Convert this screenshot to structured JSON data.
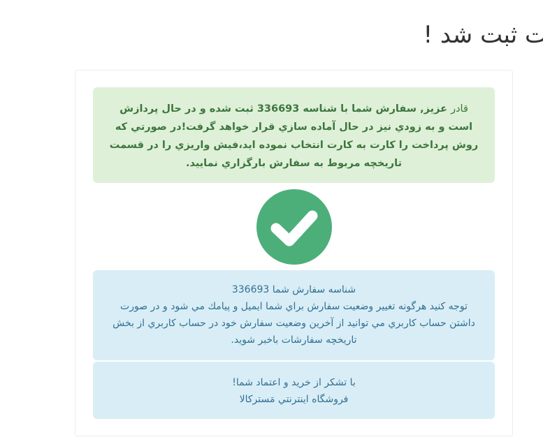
{
  "page_title": "ت ثبت شد !",
  "success_alert": {
    "name": "قادر",
    "message": "عزيز, سفارش شما با شناسه 336693 ثبت شده و در حال پردازش است و به زودي نيز در حال آماده سازي قرار خواهد گرفت!در صورتي كه روش پرداخت را كارت به كارت انتخاب نموده ايد،فيش واريزي را در قسمت تاريخچه مربوط به سفارش بارگزاري نماييد."
  },
  "check_icon": "check-circle-icon",
  "colors": {
    "success_bg": "#dff0d8",
    "success_text": "#3c763d",
    "info_bg": "#d9edf7",
    "info_text": "#31708f",
    "check_bg": "#4caf7a"
  },
  "info_alert": {
    "order_id_line": "شناسه سفارش شما 336693",
    "notice": "توجه كنيد هرگونه تغيير وضعيت سفارش براي شما ايميل و پيامك مي شود و در صورت داشتن حساب كاربري مي توانيد از آخرين وضعيت سفارش خود در حساب كاربري از بخش تاريخچه سفارشات باخبر شويد."
  },
  "thanks_alert": {
    "line1": "با تشكر از خريد و اعتماد شما!",
    "line2": "فروشگاه اينترنتي مَستركالا"
  }
}
